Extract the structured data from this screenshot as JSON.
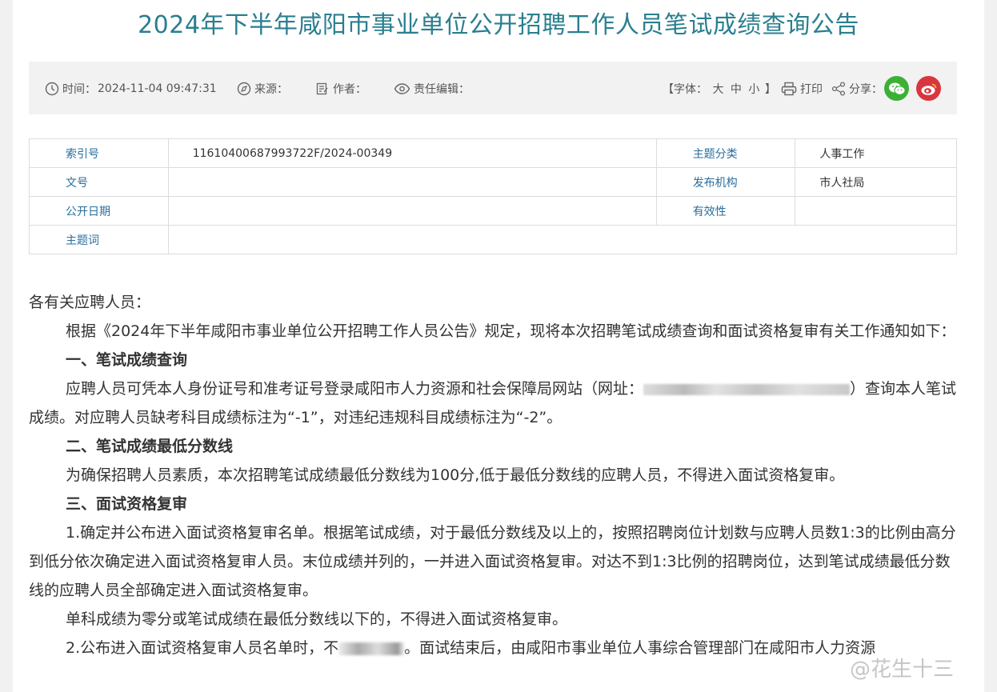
{
  "title": "2024年下半年咸阳市事业单位公开招聘工作人员笔试成绩查询公告",
  "meta": {
    "time_label": "时间：",
    "time_value": "2024-11-04 09:47:31",
    "source_label": "来源：",
    "author_label": "作者：",
    "editor_label": "责任编辑：",
    "font_prefix": "【字体：",
    "font_large": "大",
    "font_medium": "中",
    "font_small": "小",
    "font_suffix": "】",
    "print_label": "打印",
    "share_label": "分享：",
    "icons": [
      "clock-icon",
      "compass-icon",
      "edit-icon",
      "eye-icon",
      "printer-icon",
      "share-icon",
      "wechat-icon",
      "weibo-icon"
    ]
  },
  "info_table": {
    "index_label": "索引号",
    "index_value": "11610400687993722F/2024-00349",
    "topic_label": "主题分类",
    "topic_value": "人事工作",
    "doc_no_label": "文号",
    "doc_no_value": "",
    "publisher_label": "发布机构",
    "publisher_value": "市人社局",
    "open_date_label": "公开日期",
    "open_date_value": "",
    "validity_label": "有效性",
    "validity_value": "",
    "keywords_label": "主题词",
    "keywords_value": ""
  },
  "article": {
    "greeting": "各有关应聘人员：",
    "intro": "根据《2024年下半年咸阳市事业单位公开招聘工作人员公告》规定，现将本次招聘笔试成绩查询和面试资格复审有关工作通知如下：",
    "h1": "一、笔试成绩查询",
    "p1_before": "应聘人员可凭本人身份证号和准考证号登录咸阳市人力资源和社会保障局网站（网址：",
    "p1_after": "）查询本人笔试成绩。对应聘人员缺考科目成绩标注为“-1”，对违纪违规科目成绩标注为“-2”。",
    "h2": "二、笔试成绩最低分数线",
    "p2": "为确保招聘人员素质，本次招聘笔试成绩最低分数线为100分,低于最低分数线的应聘人员，不得进入面试资格复审。",
    "h3": "三、面试资格复审",
    "p3": "1.确定并公布进入面试资格复审名单。根据笔试成绩，对于最低分数线及以上的，按照招聘岗位计划数与应聘人员数1:3的比例由高分到低分依次确定进入面试资格复审人员。末位成绩并列的，一并进入面试资格复审。对达不到1:3比例的招聘岗位，达到笔试成绩最低分数线的应聘人员全部确定进入面试资格复审。",
    "p4": "单科成绩为零分或笔试成绩在最低分数线以下的，不得进入面试资格复审。",
    "p5_before": "2.公布进入面试资格复审人员名单时，不",
    "p5_after": "。面试结束后，由咸阳市事业单位人事综合管理部门在咸阳市人力资源"
  },
  "watermark": "@花生十三"
}
